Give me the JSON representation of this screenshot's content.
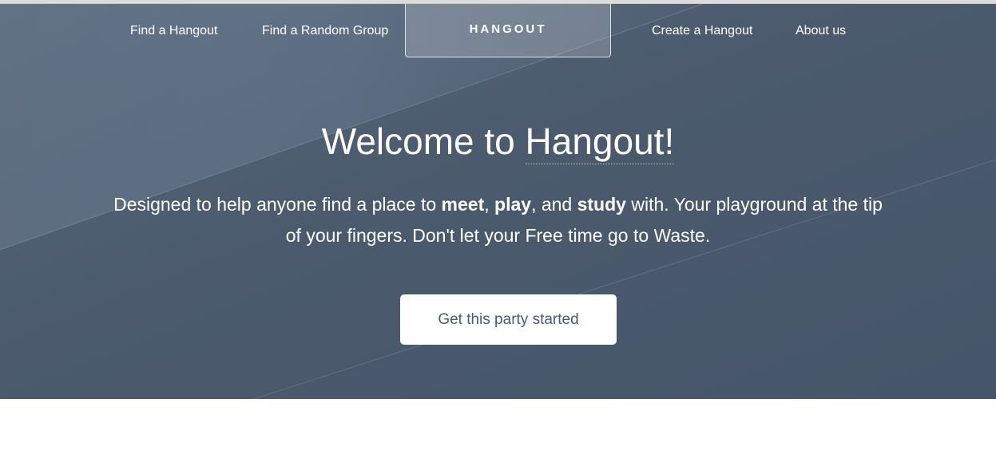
{
  "nav": {
    "find_hangout": "Find a Hangout",
    "find_random_group": "Find a Random Group",
    "brand": "HANGOUT",
    "create_hangout": "Create a Hangout",
    "about_us": "About us"
  },
  "hero": {
    "headline_prefix": "Welcome to",
    "headline_brand": "Hangout!",
    "tagline": {
      "t1": "Designed to help anyone find a place to ",
      "b1": "meet",
      "t2": ", ",
      "b2": "play",
      "t3": ", and ",
      "b3": "study",
      "t4": " with. Your playground at the tip of your fingers. Don't let your Free time go to Waste."
    },
    "cta_label": "Get this party started"
  },
  "colors": {
    "hero_background": "#4b5a6d",
    "hero_highlight": "#6b7a8c",
    "text": "#ffffff",
    "button_text": "#4b5a6d",
    "page_background": "#ffffff"
  }
}
